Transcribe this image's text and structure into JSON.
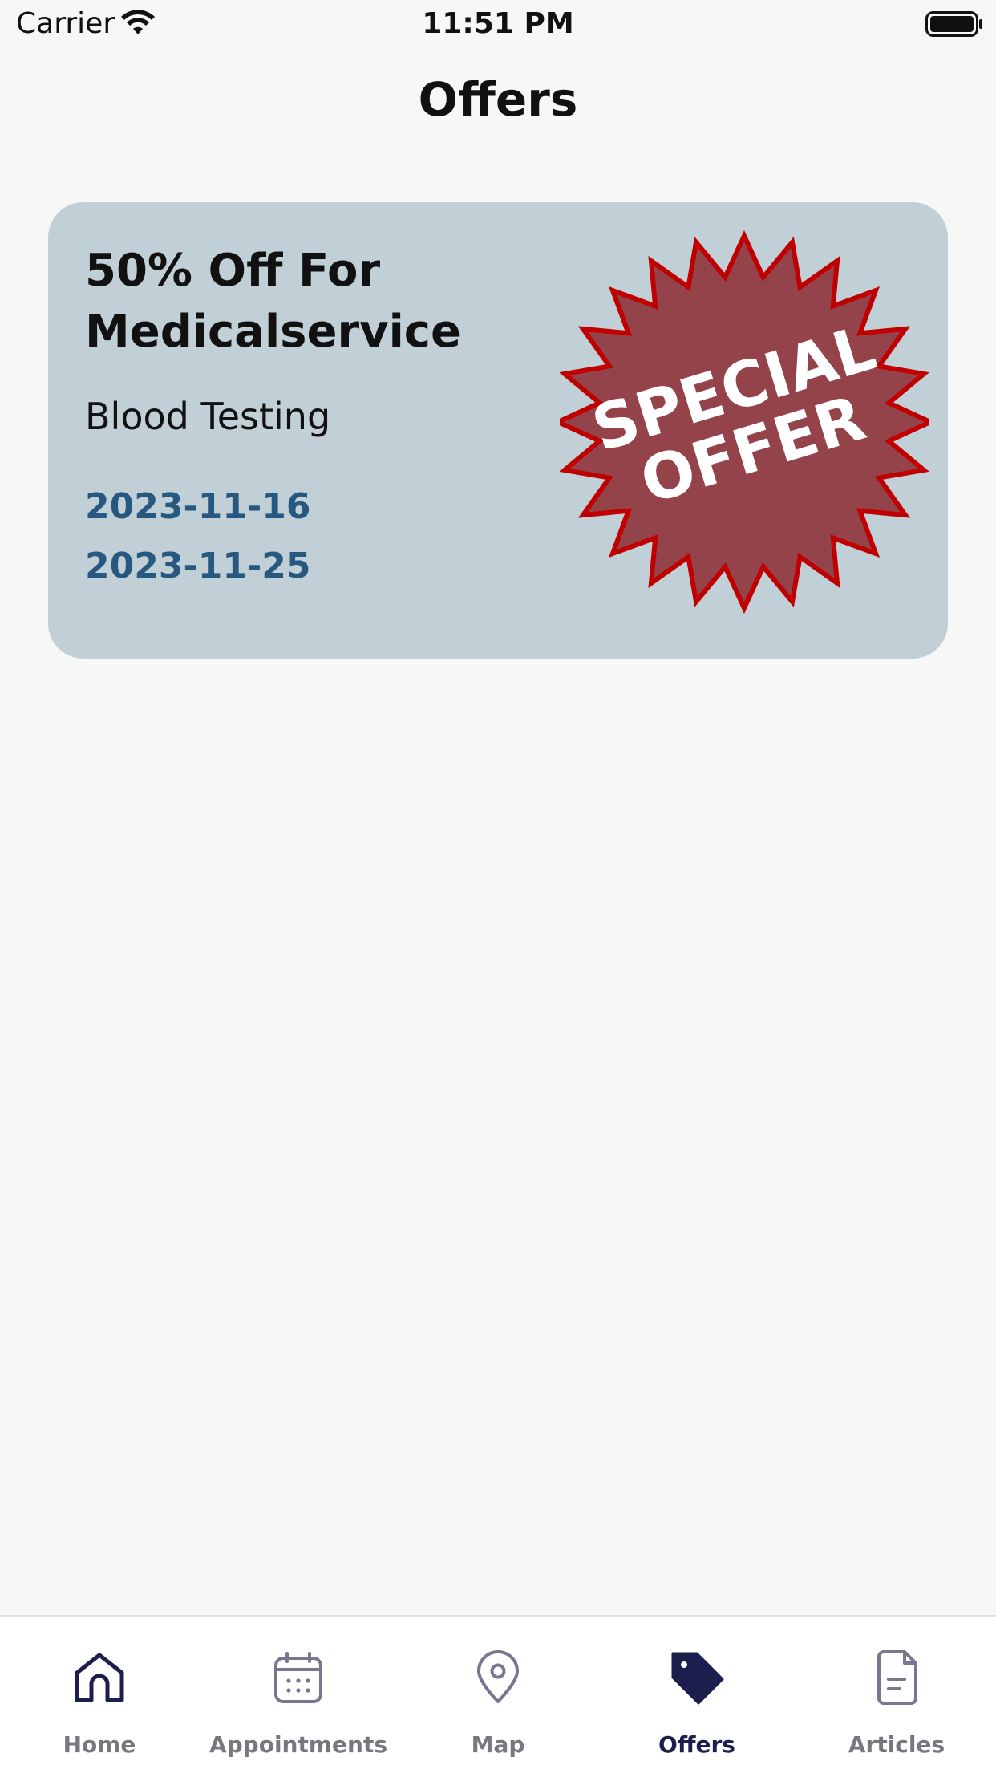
{
  "status_bar": {
    "carrier": "Carrier",
    "time": "11:51 PM",
    "wifi_icon": "wifi-icon",
    "battery_icon": "battery-icon"
  },
  "header": {
    "title": "Offers"
  },
  "offers": [
    {
      "title": "50% Off For Medicalservice",
      "service": "Blood Testing",
      "start_date": "2023-11-16",
      "end_date": "2023-11-25",
      "badge": {
        "line1": "SPECIAL",
        "line2": "OFFER",
        "fill_color": "#94434a",
        "stroke_color": "#c00000"
      }
    }
  ],
  "tab_bar": {
    "active_color": "#1c1e4e",
    "inactive_color": "#77777d",
    "tabs": [
      {
        "label": "Home",
        "icon": "home-icon",
        "active": false
      },
      {
        "label": "Appointments",
        "icon": "calendar-icon",
        "active": false
      },
      {
        "label": "Map",
        "icon": "map-pin-icon",
        "active": false
      },
      {
        "label": "Offers",
        "icon": "tag-icon",
        "active": true
      },
      {
        "label": "Articles",
        "icon": "document-icon",
        "active": false
      }
    ]
  },
  "colors": {
    "background": "#f7f7f8",
    "card_background": "#c1cfd7",
    "date_color": "#275880"
  }
}
